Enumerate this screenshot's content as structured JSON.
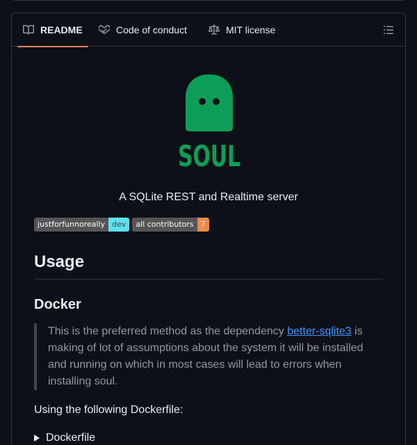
{
  "tabs": [
    {
      "label": "README",
      "icon": "book-icon",
      "active": true
    },
    {
      "label": "Code of conduct",
      "icon": "code-of-conduct-icon",
      "active": false
    },
    {
      "label": "MIT license",
      "icon": "law-icon",
      "active": false
    }
  ],
  "outline_icon": "list-unordered-icon",
  "logo": {
    "text": "SOUL",
    "color": "#0c9d58"
  },
  "tagline": "A SQLite REST and Realtime server",
  "badges": [
    {
      "label": "justforfunnoreally",
      "value": "dev",
      "value_color": "#5ee0f5"
    },
    {
      "label": "all contributors",
      "value": "7",
      "value_color": "#f08a4b"
    }
  ],
  "usage_heading": "Usage",
  "docker_heading": "Docker",
  "quote": {
    "before": "This is the preferred method as the dependency ",
    "link": "better-sqlite3",
    "after": " is making of lot of assumptions about the system it will be installed and running on which in most cases will lead to errors when installing soul."
  },
  "dockerfile_intro": "Using the following Dockerfile:",
  "details_summary": "Dockerfile",
  "colors": {
    "accent": "#f78166",
    "link": "#4493f8",
    "bg": "#0d1117",
    "border": "#30363d"
  }
}
